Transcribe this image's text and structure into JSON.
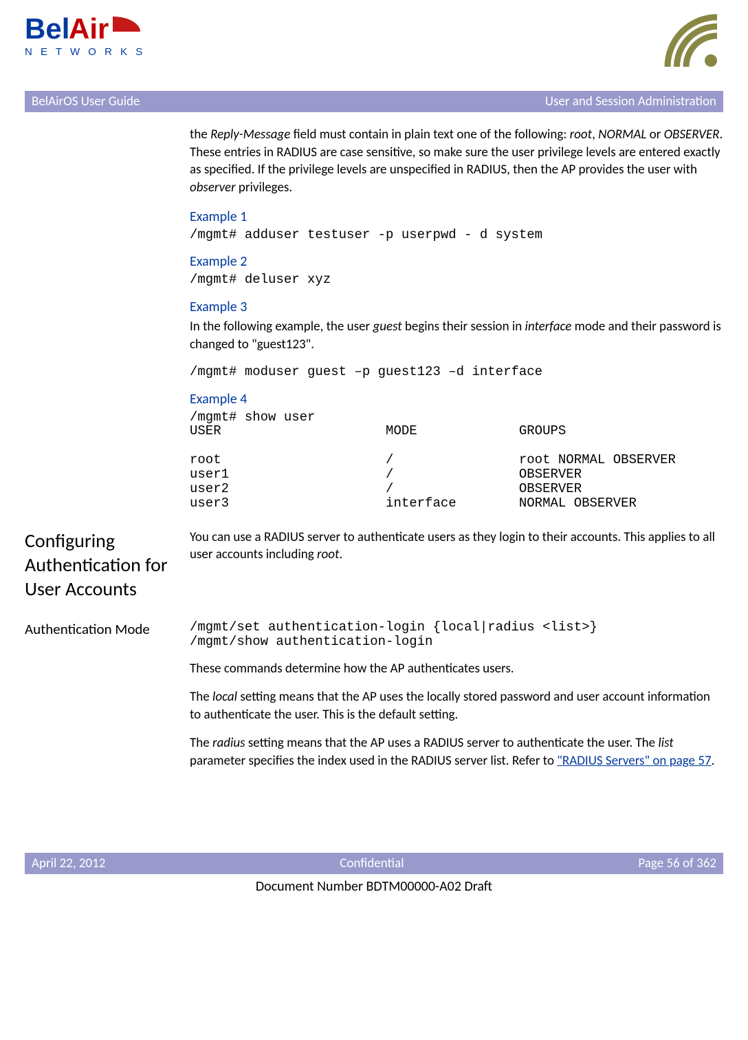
{
  "logo": {
    "brand_top": "BelAir",
    "brand_bottom": "N E T W O R K S"
  },
  "header": {
    "left": "BelAirOS User Guide",
    "right": "User and Session Administration"
  },
  "intro": {
    "t1": "the ",
    "reply_msg": "Reply-Message",
    "t2": " field must contain in plain text one of the following: ",
    "root": "root",
    "t3": ", ",
    "normal": "NORMAL",
    "t4": " or ",
    "observer": "OBSERVER",
    "t5": ". These entries in RADIUS are case sensitive, so make sure the user privilege levels are entered exactly as specified. If the privilege levels are unspecified in RADIUS, then the AP provides the user with ",
    "observer2": "observer",
    "t6": " privileges."
  },
  "ex1": {
    "heading": "Example 1",
    "cmd": "/mgmt# adduser testuser -p userpwd - d system"
  },
  "ex2": {
    "heading": "Example 2",
    "cmd": "/mgmt# deluser xyz"
  },
  "ex3": {
    "heading": "Example 3",
    "t1": "In the following example, the user ",
    "guest": "guest",
    "t2": " begins their session in ",
    "interface": "interface",
    "t3": " mode and their password is changed to \"guest123\".",
    "cmd": "/mgmt# moduser guest –p guest123 –d interface"
  },
  "ex4": {
    "heading": "Example 4",
    "out": "/mgmt# show user\nUSER                     MODE             GROUPS\n\nroot                     /                root NORMAL OBSERVER\nuser1                    /                OBSERVER\nuser2                    /                OBSERVER\nuser3                    interface        NORMAL OBSERVER"
  },
  "section": {
    "heading": "Configuring Authentication for User Accounts",
    "t1": "You can use a RADIUS server to authenticate users as they login to their accounts. This applies to all user accounts including ",
    "root": "root",
    "t2": "."
  },
  "auth": {
    "heading": "Authentication Mode",
    "cmds": "/mgmt/set authentication-login {local|radius <list>}\n/mgmt/show authentication-login",
    "p1": "These commands determine how the AP authenticates users.",
    "p2a": "The ",
    "p2_local": "local",
    "p2b": " setting means that the AP uses the locally stored password and user account information to authenticate the user. This is the default setting.",
    "p3a": "The ",
    "p3_radius": "radius",
    "p3b": " setting means that the AP uses a RADIUS server to authenticate the user. The ",
    "p3_list": "list",
    "p3c": " parameter specifies the index used in the RADIUS server list. Refer to ",
    "link": "\"RADIUS Servers\" on page 57",
    "p3d": "."
  },
  "footer": {
    "date": "April 22, 2012",
    "mid": "Confidential",
    "page": "Page 56 of 362",
    "docnum": "Document Number BDTM00000-A02 Draft"
  }
}
